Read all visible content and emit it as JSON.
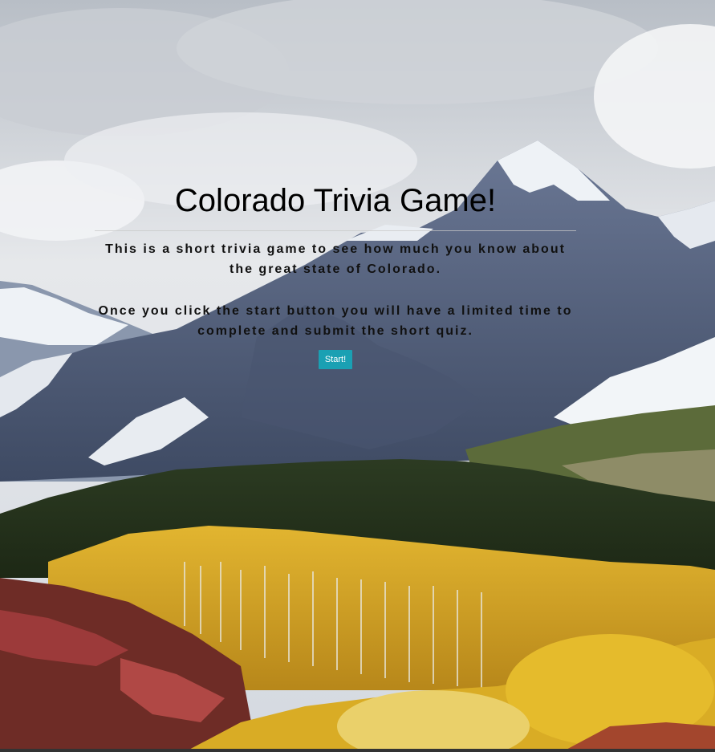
{
  "game": {
    "title": "Colorado Trivia Game!",
    "intro_line1": "This is a short trivia game to see how much you know about",
    "intro_line2": "the great state of Colorado.",
    "instructions_line1": "Once you click the start button you will have a limited time to",
    "instructions_line2": "complete and submit the short quiz.",
    "start_label": "Start!"
  },
  "background": {
    "sky_color": "#d9dde2",
    "mountain_color": "#5b6a86",
    "snow_color": "#eef2f6",
    "forest_dark": "#22331c",
    "aspen_gold": "#d8a51f",
    "red_shrubs": "#8c2f2a",
    "accent": "#1aa0b3"
  }
}
